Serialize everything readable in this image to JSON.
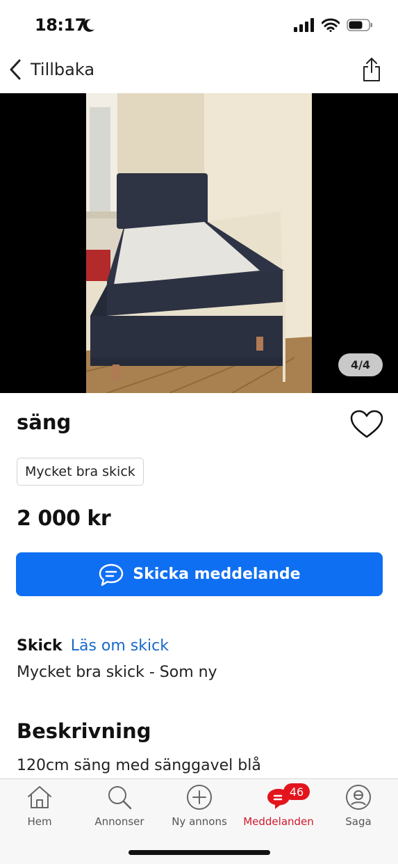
{
  "status": {
    "time": "18:17",
    "icons": [
      "moon-icon",
      "signal-icon",
      "wifi-icon",
      "battery-icon"
    ]
  },
  "nav": {
    "back_label": "Tillbaka",
    "share_icon": "share-icon"
  },
  "gallery": {
    "counter": "4/4"
  },
  "listing": {
    "title": "säng",
    "condition_tag": "Mycket bra skick",
    "price": "2 000 kr",
    "message_button": "Skicka meddelande"
  },
  "condition": {
    "heading": "Skick",
    "link": "Läs om skick",
    "value": "Mycket bra skick - Som ny"
  },
  "description": {
    "heading": "Beskrivning",
    "text": "120cm säng med sänggavel blå"
  },
  "tabs": [
    {
      "label": "Hem",
      "icon": "home-icon"
    },
    {
      "label": "Annonser",
      "icon": "search-icon"
    },
    {
      "label": "Ny annons",
      "icon": "plus-circle-icon"
    },
    {
      "label": "Meddelanden",
      "icon": "chat-icon",
      "badge": "46",
      "active": true
    },
    {
      "label": "Saga",
      "icon": "profile-icon"
    }
  ],
  "colors": {
    "accent_blue": "#0f6ff2",
    "link_blue": "#1768c9",
    "active_red": "#d0182b",
    "badge_red": "#e3141c"
  }
}
